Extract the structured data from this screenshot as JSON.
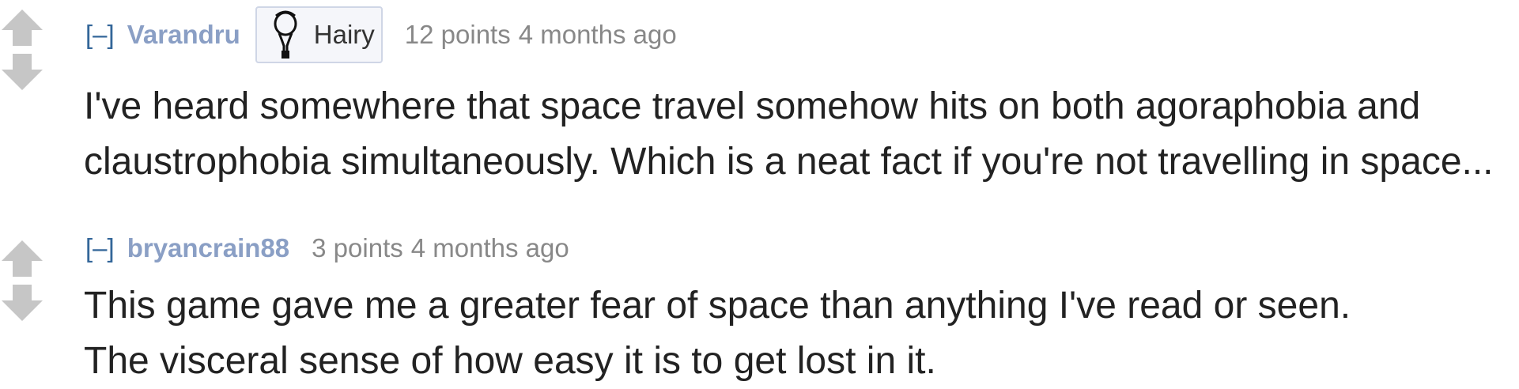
{
  "comments": [
    {
      "expand_label": "[–]",
      "author": "Varandru",
      "flair": {
        "text": "Hairy",
        "icon": "hairy-portrait-icon"
      },
      "score": "12 points",
      "time": "4 months ago",
      "body_lines": [
        "I've heard somewhere that space travel somehow hits on both agoraphobia and",
        "claustrophobia simultaneously. Which is a neat fact if you're not travelling in space..."
      ]
    },
    {
      "expand_label": "[–]",
      "author": "bryancrain88",
      "score": "3 points",
      "time": "4 months ago",
      "body_lines": [
        "This game gave me a greater fear of space than anything I've read or seen.",
        "The visceral sense of how easy it is to get lost in it."
      ]
    }
  ],
  "colors": {
    "author": "#8a9fc5",
    "expand": "#336699",
    "meta": "#888888",
    "body": "#222222",
    "arrow": "#c6c6c6"
  }
}
